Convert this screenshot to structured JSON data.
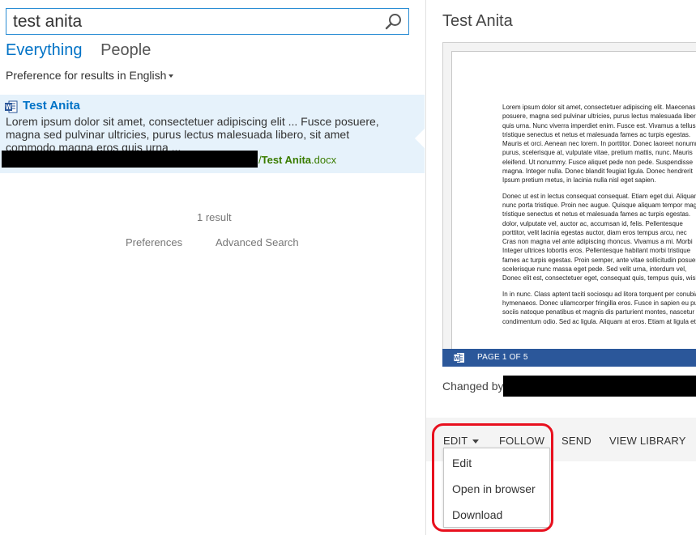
{
  "search": {
    "query": "test anita"
  },
  "verticals": {
    "everything": "Everything",
    "people": "People"
  },
  "preference": {
    "label": "Preference for results in",
    "language": "English"
  },
  "result": {
    "title": "Test Anita",
    "summary_line1": "Lorem ipsum dolor sit amet, consectetuer adipiscing elit ... Fusce posuere,",
    "summary_line2": "magna sed pulvinar ultricies, purus lectus malesuada libero, sit amet",
    "summary_line3": "commodo magna eros quis urna ...",
    "url_sep": "/",
    "url_name": "Test Anita",
    "url_ext": ".docx"
  },
  "results_count": "1 result",
  "footer": {
    "preferences": "Preferences",
    "advanced": "Advanced Search"
  },
  "preview": {
    "title": "Test Anita",
    "page_label": "PAGE 1 OF 5",
    "changed_by": "Changed by",
    "doc_paragraphs": [
      [
        "Lorem ipsum dolor sit amet, consectetuer adipiscing elit. Maecenas",
        "posuere, magna sed pulvinar ultricies, purus lectus malesuada libero,",
        "quis urna. Nunc viverra imperdiet enim. Fusce est. Vivamus a tellus.",
        "tristique senectus et netus et malesuada fames ac turpis egestas.",
        "Mauris et orci. Aenean nec lorem. In porttitor. Donec laoreet nonummy",
        "purus, scelerisque at, vulputate vitae, pretium mattis, nunc. Mauris",
        "eleifend. Ut nonummy. Fusce aliquet pede non pede. Suspendisse",
        "magna. Integer nulla. Donec blandit feugiat ligula. Donec hendrerit",
        "Ipsum pretium metus, in lacinia nulla nisl eget sapien."
      ],
      [
        "Donec ut est in lectus consequat consequat. Etiam eget dui. Aliquam",
        "nunc porta tristique. Proin nec augue. Quisque aliquam tempor magna.",
        "tristique senectus et netus et malesuada fames ac turpis egestas.",
        "dolor, vulputate vel, auctor ac, accumsan id, felis. Pellentesque",
        "porttitor, velit lacinia egestas auctor, diam eros tempus arcu, nec",
        "Cras non magna vel ante adipiscing rhoncus. Vivamus a mi. Morbi",
        "Integer ultrices lobortis eros. Pellentesque habitant morbi tristique",
        "fames ac turpis egestas. Proin semper, ante vitae sollicitudin posuere,",
        "scelerisque nunc massa eget pede. Sed velit urna, interdum vel,",
        "Donec elit est, consectetuer eget, consequat quis, tempus quis, wisi."
      ],
      [
        "In in nunc. Class aptent taciti sociosqu ad litora torquent per conubia",
        "hymenaeos. Donec ullamcorper fringilla eros. Fusce in sapien eu purus",
        "sociis natoque penatibus et magnis dis parturient montes, nascetur",
        "condimentum odio. Sed ac ligula. Aliquam at eros. Etiam at ligula et"
      ]
    ]
  },
  "actions": {
    "edit": "EDIT",
    "follow": "FOLLOW",
    "send": "SEND",
    "view_library": "VIEW LIBRARY"
  },
  "edit_menu": [
    "Edit",
    "Open in browser",
    "Download"
  ],
  "colors": {
    "accent": "#0072c6",
    "url_green": "#3a7c00",
    "word_blue": "#2b579a",
    "highlight_red": "#e8101e"
  }
}
